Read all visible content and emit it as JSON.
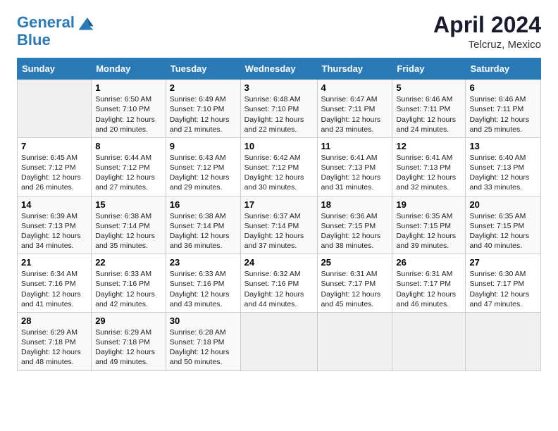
{
  "header": {
    "logo_line1": "General",
    "logo_line2": "Blue",
    "month_title": "April 2024",
    "subtitle": "Telcruz, Mexico"
  },
  "days_of_week": [
    "Sunday",
    "Monday",
    "Tuesday",
    "Wednesday",
    "Thursday",
    "Friday",
    "Saturday"
  ],
  "weeks": [
    [
      {
        "day": "",
        "empty": true
      },
      {
        "day": "1",
        "sunrise": "6:50 AM",
        "sunset": "7:10 PM",
        "daylight": "12 hours and 20 minutes."
      },
      {
        "day": "2",
        "sunrise": "6:49 AM",
        "sunset": "7:10 PM",
        "daylight": "12 hours and 21 minutes."
      },
      {
        "day": "3",
        "sunrise": "6:48 AM",
        "sunset": "7:10 PM",
        "daylight": "12 hours and 22 minutes."
      },
      {
        "day": "4",
        "sunrise": "6:47 AM",
        "sunset": "7:11 PM",
        "daylight": "12 hours and 23 minutes."
      },
      {
        "day": "5",
        "sunrise": "6:46 AM",
        "sunset": "7:11 PM",
        "daylight": "12 hours and 24 minutes."
      },
      {
        "day": "6",
        "sunrise": "6:46 AM",
        "sunset": "7:11 PM",
        "daylight": "12 hours and 25 minutes."
      }
    ],
    [
      {
        "day": "7",
        "sunrise": "6:45 AM",
        "sunset": "7:12 PM",
        "daylight": "12 hours and 26 minutes."
      },
      {
        "day": "8",
        "sunrise": "6:44 AM",
        "sunset": "7:12 PM",
        "daylight": "12 hours and 27 minutes."
      },
      {
        "day": "9",
        "sunrise": "6:43 AM",
        "sunset": "7:12 PM",
        "daylight": "12 hours and 29 minutes."
      },
      {
        "day": "10",
        "sunrise": "6:42 AM",
        "sunset": "7:12 PM",
        "daylight": "12 hours and 30 minutes."
      },
      {
        "day": "11",
        "sunrise": "6:41 AM",
        "sunset": "7:13 PM",
        "daylight": "12 hours and 31 minutes."
      },
      {
        "day": "12",
        "sunrise": "6:41 AM",
        "sunset": "7:13 PM",
        "daylight": "12 hours and 32 minutes."
      },
      {
        "day": "13",
        "sunrise": "6:40 AM",
        "sunset": "7:13 PM",
        "daylight": "12 hours and 33 minutes."
      }
    ],
    [
      {
        "day": "14",
        "sunrise": "6:39 AM",
        "sunset": "7:13 PM",
        "daylight": "12 hours and 34 minutes."
      },
      {
        "day": "15",
        "sunrise": "6:38 AM",
        "sunset": "7:14 PM",
        "daylight": "12 hours and 35 minutes."
      },
      {
        "day": "16",
        "sunrise": "6:38 AM",
        "sunset": "7:14 PM",
        "daylight": "12 hours and 36 minutes."
      },
      {
        "day": "17",
        "sunrise": "6:37 AM",
        "sunset": "7:14 PM",
        "daylight": "12 hours and 37 minutes."
      },
      {
        "day": "18",
        "sunrise": "6:36 AM",
        "sunset": "7:15 PM",
        "daylight": "12 hours and 38 minutes."
      },
      {
        "day": "19",
        "sunrise": "6:35 AM",
        "sunset": "7:15 PM",
        "daylight": "12 hours and 39 minutes."
      },
      {
        "day": "20",
        "sunrise": "6:35 AM",
        "sunset": "7:15 PM",
        "daylight": "12 hours and 40 minutes."
      }
    ],
    [
      {
        "day": "21",
        "sunrise": "6:34 AM",
        "sunset": "7:16 PM",
        "daylight": "12 hours and 41 minutes."
      },
      {
        "day": "22",
        "sunrise": "6:33 AM",
        "sunset": "7:16 PM",
        "daylight": "12 hours and 42 minutes."
      },
      {
        "day": "23",
        "sunrise": "6:33 AM",
        "sunset": "7:16 PM",
        "daylight": "12 hours and 43 minutes."
      },
      {
        "day": "24",
        "sunrise": "6:32 AM",
        "sunset": "7:16 PM",
        "daylight": "12 hours and 44 minutes."
      },
      {
        "day": "25",
        "sunrise": "6:31 AM",
        "sunset": "7:17 PM",
        "daylight": "12 hours and 45 minutes."
      },
      {
        "day": "26",
        "sunrise": "6:31 AM",
        "sunset": "7:17 PM",
        "daylight": "12 hours and 46 minutes."
      },
      {
        "day": "27",
        "sunrise": "6:30 AM",
        "sunset": "7:17 PM",
        "daylight": "12 hours and 47 minutes."
      }
    ],
    [
      {
        "day": "28",
        "sunrise": "6:29 AM",
        "sunset": "7:18 PM",
        "daylight": "12 hours and 48 minutes."
      },
      {
        "day": "29",
        "sunrise": "6:29 AM",
        "sunset": "7:18 PM",
        "daylight": "12 hours and 49 minutes."
      },
      {
        "day": "30",
        "sunrise": "6:28 AM",
        "sunset": "7:18 PM",
        "daylight": "12 hours and 50 minutes."
      },
      {
        "day": "",
        "empty": true
      },
      {
        "day": "",
        "empty": true
      },
      {
        "day": "",
        "empty": true
      },
      {
        "day": "",
        "empty": true
      }
    ]
  ],
  "labels": {
    "sunrise": "Sunrise:",
    "sunset": "Sunset:",
    "daylight": "Daylight:"
  }
}
